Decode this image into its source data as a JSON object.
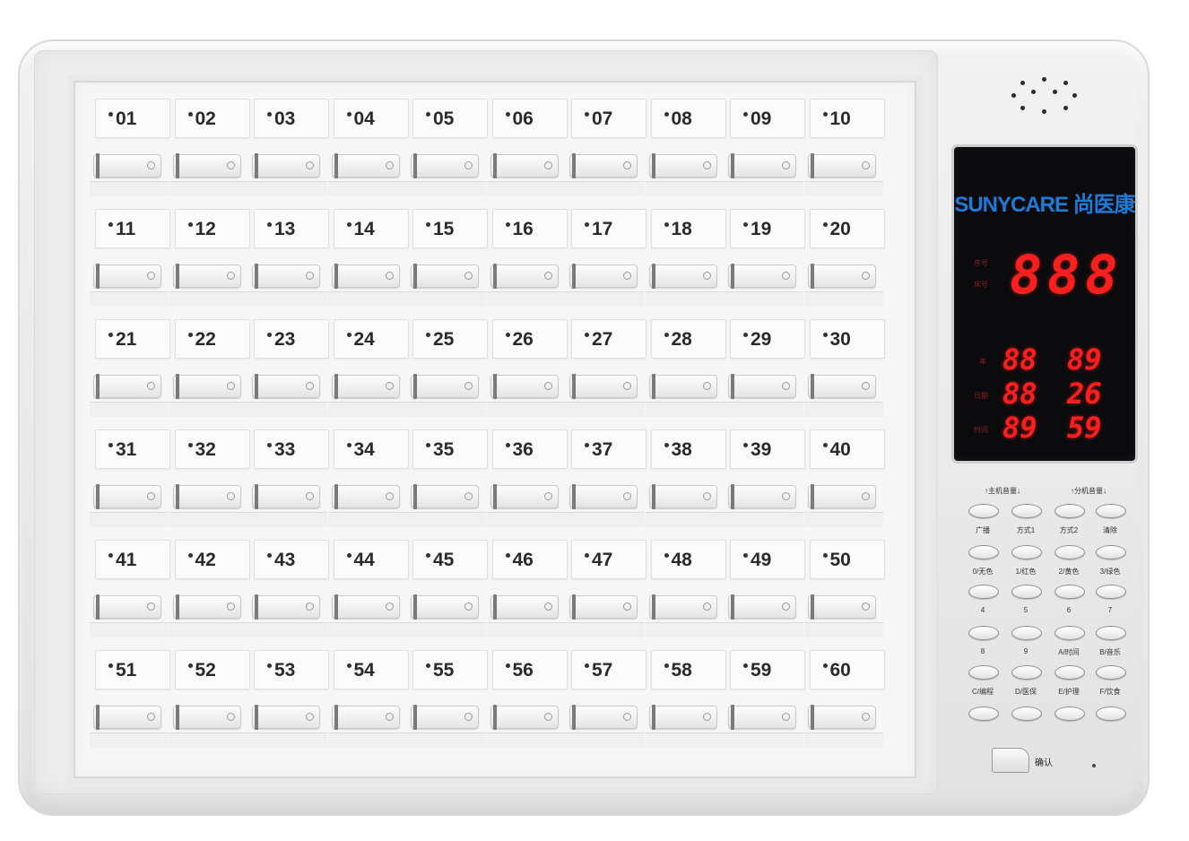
{
  "cells": [
    "01",
    "02",
    "03",
    "04",
    "05",
    "06",
    "07",
    "08",
    "09",
    "10",
    "11",
    "12",
    "13",
    "14",
    "15",
    "16",
    "17",
    "18",
    "19",
    "20",
    "21",
    "22",
    "23",
    "24",
    "25",
    "26",
    "27",
    "28",
    "29",
    "30",
    "31",
    "32",
    "33",
    "34",
    "35",
    "36",
    "37",
    "38",
    "39",
    "40",
    "41",
    "42",
    "43",
    "44",
    "45",
    "46",
    "47",
    "48",
    "49",
    "50",
    "51",
    "52",
    "53",
    "54",
    "55",
    "56",
    "57",
    "58",
    "59",
    "60"
  ],
  "brand": {
    "name": "SUNYCARE 尚医康"
  },
  "display": {
    "main_digits": "888",
    "labels": [
      "序号",
      "床号",
      "年",
      "日期",
      "时间"
    ],
    "rows": [
      [
        "88",
        "89"
      ],
      [
        "88",
        "26"
      ],
      [
        "89",
        "59"
      ]
    ]
  },
  "volume": {
    "host": "↑主机音量↓",
    "ext": "↑分机音量↓"
  },
  "keypad": [
    [
      "广播",
      "方式1",
      "方式2",
      "清除"
    ],
    [
      "0/无色",
      "1/红色",
      "2/黄色",
      "3/绿色"
    ],
    [
      "4",
      "5",
      "6",
      "7"
    ],
    [
      "8",
      "9",
      "A/时间",
      "B/音乐"
    ],
    [
      "C/编程",
      "D/医保",
      "E/护理",
      "F/饮食"
    ]
  ],
  "confirm": "确认"
}
